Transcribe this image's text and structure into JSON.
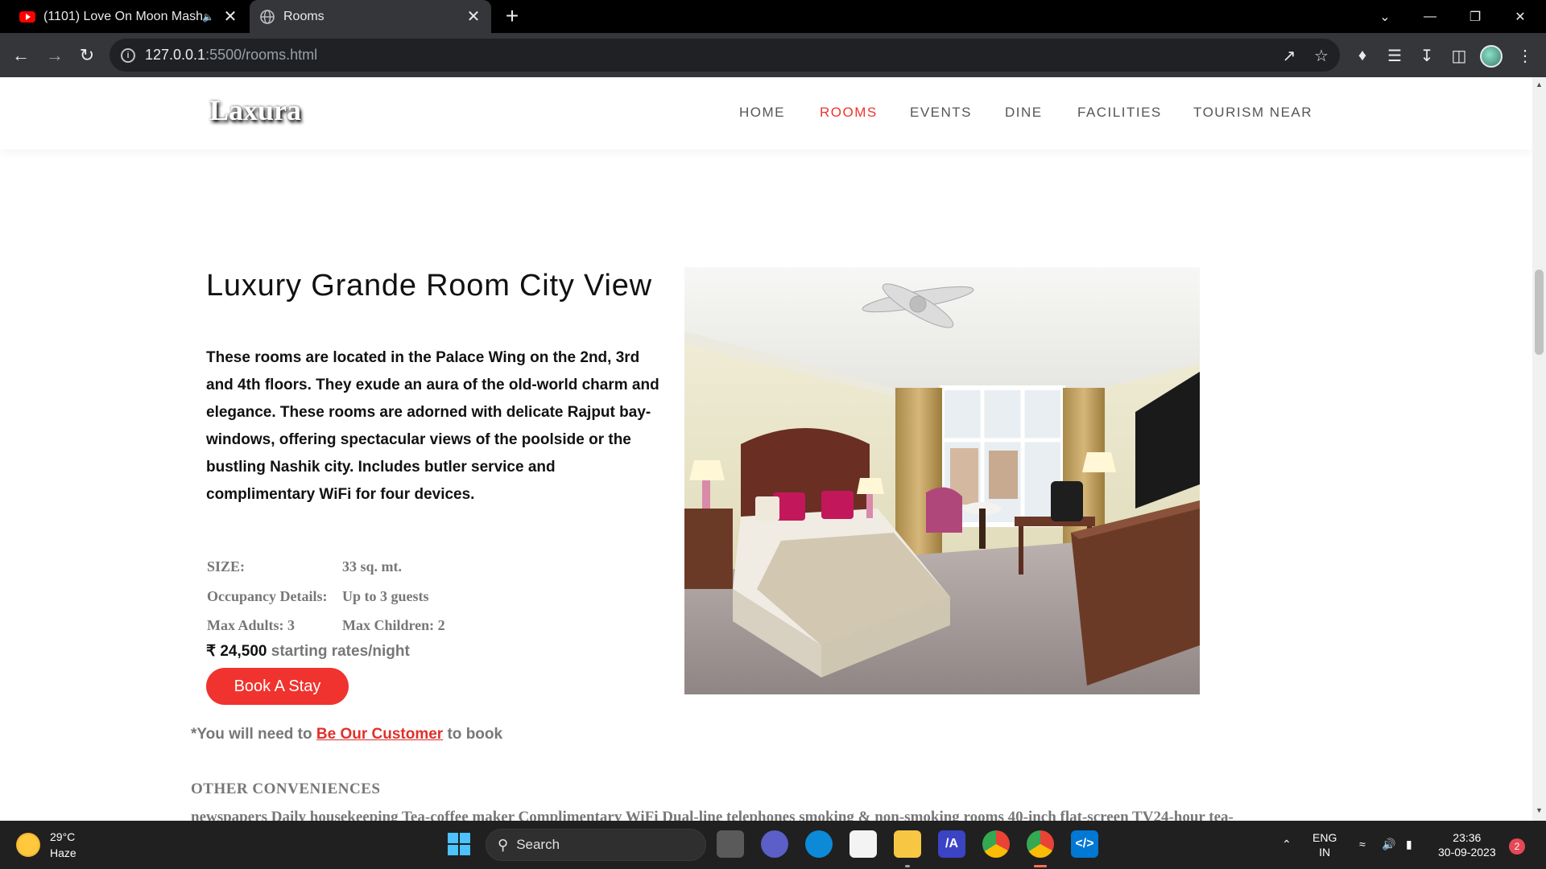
{
  "browser": {
    "tabs": [
      {
        "title": "(1101) Love On Moon Mash",
        "favicon": "youtube-icon",
        "audio": true
      },
      {
        "title": "Rooms",
        "favicon": "globe-icon",
        "active": true
      }
    ],
    "url_host": "127.0.0.1",
    "url_path": ":5500/rooms.html"
  },
  "site": {
    "logo": "Laxura",
    "nav": [
      "HOME",
      "ROOMS",
      "EVENTS",
      "DINE",
      "FACILITIES",
      "TOURISM NEAR"
    ],
    "active_nav": "ROOMS",
    "accent_color": "#f0332e"
  },
  "room": {
    "title": "Luxury Grande Room City View",
    "description": "These rooms are located in the Palace Wing on the 2nd, 3rd and 4th floors. They exude an aura of the old-world charm and elegance. These rooms are adorned with delicate Rajput bay-windows, offering spectacular views of the poolside or the bustling Nashik city. Includes butler service and complimentary WiFi for four devices.",
    "specs": {
      "size_label": "SIZE:",
      "size_value": "33 sq. mt.",
      "occupancy_label": "Occupancy Details:",
      "occupancy_value": "Up to 3 guests",
      "max_adults": "Max Adults: 3",
      "max_children": "Max Children: 2"
    },
    "price_amount": "₹ 24,500",
    "price_suffix": " starting rates/night",
    "book_button": "Book A Stay",
    "note_prefix": "*You will need to ",
    "note_link": "Be Our Customer",
    "note_suffix": " to book",
    "other_heading": "OTHER CONVENIENCES",
    "other_list": "newspapers Daily housekeeping Tea-coffee maker Complimentary WiFi Dual-line telephones smoking & non-smoking rooms 40-inch flat-screen TV24-hour tea-"
  },
  "taskbar": {
    "temperature": "29°C",
    "condition": "Haze",
    "search_placeholder": "Search",
    "lang_top": "ENG",
    "lang_bottom": "IN",
    "time": "23:36",
    "date": "30-09-2023",
    "notifications": "2"
  }
}
